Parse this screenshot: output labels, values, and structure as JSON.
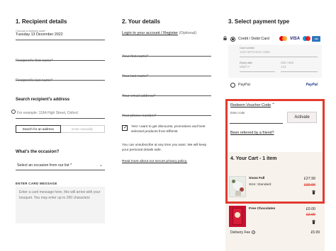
{
  "recipient": {
    "title": "1. Recipient details",
    "delivery_label": "Choose a delivery date*",
    "delivery_value": "Tuesday 13 December 2022",
    "first_name_ph": "Recipient's first name*",
    "last_name_ph": "Recipient's last name*",
    "search_title": "Search recipient's address",
    "search_ph": "For example: 116A High Street, Oxford",
    "search_btn": "Search for an address",
    "manual_btn": "Enter manually",
    "occasion_title": "What's the occasion?",
    "occasion_value": "Select an occasion from our list *",
    "card_msg_label": "ENTER CARD MESSAGE",
    "card_msg_ph": "Enter a card message here, this will arrive with your bouquet. You may enter up to 200 characters"
  },
  "details": {
    "title": "2. Your details",
    "login_link": "Login to your account / Register",
    "login_opt": "(Optional)",
    "first_name_ph": "Your first name*",
    "last_name_ph": "Your last name*",
    "email_ph": "Your email address*",
    "phone_ph": "Your phone number*",
    "consent_text": "Yes! I want to get discounts, promotions and best selected products from Elflorist",
    "unsub_text": "You can unsubscribe at any time you want. We will keep your personal details safe.",
    "privacy_link": "Read more about our secure privacy policy."
  },
  "payment": {
    "title": "3. Select payment type",
    "card_option": "Credit / Debit Card",
    "logos": [
      "mastercard",
      "VISA",
      "maestro",
      "amex"
    ],
    "card_number_label": "Card number",
    "card_number_ph": "1234 5678 9012 3456",
    "expiry_label": "Expiry date",
    "expiry_ph": "MM/YY",
    "cvc_label": "CVC / CVV",
    "cvc_ph": "123",
    "paypal_option": "PayPal",
    "paypal_logo": "PayPal"
  },
  "voucher": {
    "link": "Redeem Voucher Code",
    "input_label": "Enter code",
    "activate_btn": "Activate",
    "referred_link": "Been referred by a friend?"
  },
  "cart": {
    "title": "4. Your Cart - 1 item",
    "items": [
      {
        "name": "Snow Fall",
        "size": "Size: Standard",
        "price": "£27.99",
        "was": "£32.99"
      },
      {
        "name": "Free Chocolates",
        "price": "£0.00",
        "was": "£2.99"
      }
    ],
    "delivery_label": "Delivery Fee",
    "delivery_fee": "£5.99"
  },
  "colors": {
    "highlight": "#e33b2e",
    "cart_bg": "#f7f2ec",
    "strike": "#e33b2e"
  }
}
